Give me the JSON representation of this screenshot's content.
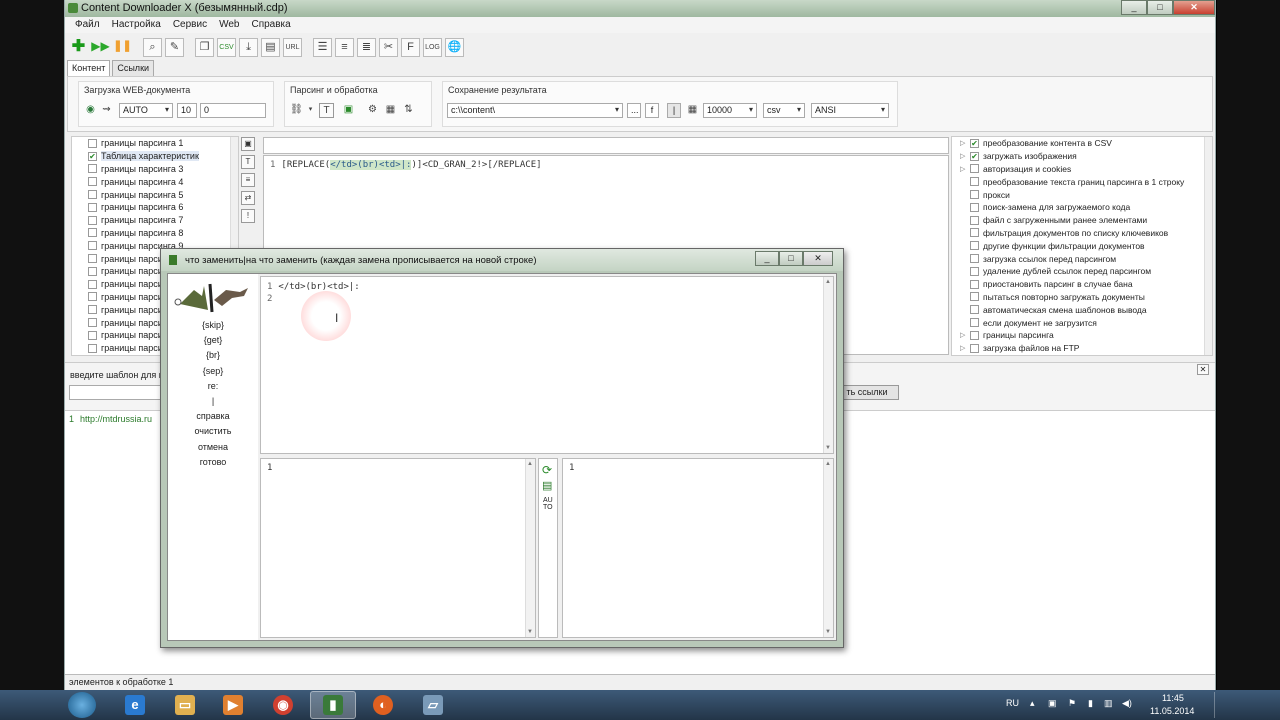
{
  "window": {
    "title": "Content Downloader X (безымянный.cdp)",
    "controls": [
      "_",
      "□",
      "✕"
    ]
  },
  "menu": [
    "Файл",
    "Настройка",
    "Сервис",
    "Web",
    "Справка"
  ],
  "tabs": [
    "Контент",
    "Ссылки"
  ],
  "settings": {
    "web_group_label": "Загрузка WEB-документа",
    "mode_value": "AUTO",
    "threads_value": "10",
    "delay_value": "0",
    "parse_group_label": "Парсинг и обработка",
    "save_group_label": "Сохранение результата",
    "path_value": "c:\\\\content\\",
    "path_button": "...",
    "f_button": "f",
    "limit_value": "10000",
    "format_value": "csv",
    "encoding_value": "ANSI"
  },
  "left_tree": [
    {
      "label": "границы парсинга 1",
      "checked": false,
      "selected": false
    },
    {
      "label": "Таблица характеристик",
      "checked": true,
      "selected": true
    },
    {
      "label": "границы парсинга 3",
      "checked": false,
      "selected": false
    },
    {
      "label": "границы парсинга 4",
      "checked": false,
      "selected": false
    },
    {
      "label": "границы парсинга 5",
      "checked": false,
      "selected": false
    },
    {
      "label": "границы парсинга 6",
      "checked": false,
      "selected": false
    },
    {
      "label": "границы парсинга 7",
      "checked": false,
      "selected": false
    },
    {
      "label": "границы парсинга 8",
      "checked": false,
      "selected": false
    },
    {
      "label": "границы парсинга 9",
      "checked": false,
      "selected": false
    },
    {
      "label": "границы парси",
      "checked": false,
      "selected": false
    },
    {
      "label": "границы парси",
      "checked": false,
      "selected": false
    },
    {
      "label": "границы парси",
      "checked": false,
      "selected": false
    },
    {
      "label": "границы парси",
      "checked": false,
      "selected": false
    },
    {
      "label": "границы парси",
      "checked": false,
      "selected": false
    },
    {
      "label": "границы парси",
      "checked": false,
      "selected": false
    },
    {
      "label": "границы парси",
      "checked": false,
      "selected": false
    },
    {
      "label": "границы парси",
      "checked": false,
      "selected": false
    }
  ],
  "editor": {
    "line_no": "1",
    "code_before": "[REPLACE(",
    "code_highlight": "</td>(br)<td>|:",
    "code_after": ")]<CD_GRAN_2!>[/REPLACE]"
  },
  "right_tree": [
    {
      "label": "преобразование контента в CSV",
      "checked": true,
      "expander": true
    },
    {
      "label": "загружать изображения",
      "checked": true,
      "expander": true
    },
    {
      "label": "авторизация и cookies",
      "checked": false,
      "expander": true
    },
    {
      "label": "преобразование текста границ парсинга в 1 строку",
      "checked": false,
      "expander": false
    },
    {
      "label": "прокси",
      "checked": false,
      "expander": false
    },
    {
      "label": "поиск-замена для загружаемого кода",
      "checked": false,
      "expander": false
    },
    {
      "label": "файл с загруженными ранее элементами",
      "checked": false,
      "expander": false
    },
    {
      "label": "фильтрация документов по списку ключевиков",
      "checked": false,
      "expander": false
    },
    {
      "label": "другие функции фильтрации документов",
      "checked": false,
      "expander": false
    },
    {
      "label": "загрузка ссылок перед парсингом",
      "checked": false,
      "expander": false
    },
    {
      "label": "удаление дублей ссылок перед парсингом",
      "checked": false,
      "expander": false
    },
    {
      "label": "приостановить парсинг в случае бана",
      "checked": false,
      "expander": false
    },
    {
      "label": "пытаться повторно загружать документы",
      "checked": false,
      "expander": false
    },
    {
      "label": "автоматическая смена шаблонов вывода",
      "checked": false,
      "expander": false
    },
    {
      "label": "если документ не загрузится",
      "checked": false,
      "expander": false
    },
    {
      "label": "границы парсинга",
      "checked": false,
      "expander": true
    },
    {
      "label": "загрузка файлов на FTP",
      "checked": false,
      "expander": true
    }
  ],
  "bottom": {
    "template_label": "введите шаблон для п",
    "links_button": "ть ссылки",
    "close_x": "✕",
    "url_row_no": "1",
    "url_row_text": "http://mtdrussia.ru"
  },
  "status": {
    "text": "элементов к обработке 1"
  },
  "dialog": {
    "title": "что заменить|на что заменить (каждая замена прописывается на новой строке)",
    "side_links": [
      "{skip}",
      "{get}",
      "{br}",
      "{sep}",
      "re:",
      "|",
      "справка",
      "очистить",
      "отмена",
      "готово"
    ],
    "top_editor_lines": [
      {
        "n": "1",
        "text": "</td>(br)<td>|:"
      },
      {
        "n": "2",
        "text": ""
      }
    ],
    "bottom_left_line": "1",
    "bottom_right_line": "1",
    "auto_label": "AU\nTO"
  },
  "taskbar": {
    "lang": "RU",
    "time": "11:45",
    "date": "11.05.2014"
  },
  "colors": {
    "titlebar": "#b4c8b4",
    "highlight": "#cfe6c8",
    "check": "#2a8a2a",
    "taskbar": "#2d4560"
  }
}
